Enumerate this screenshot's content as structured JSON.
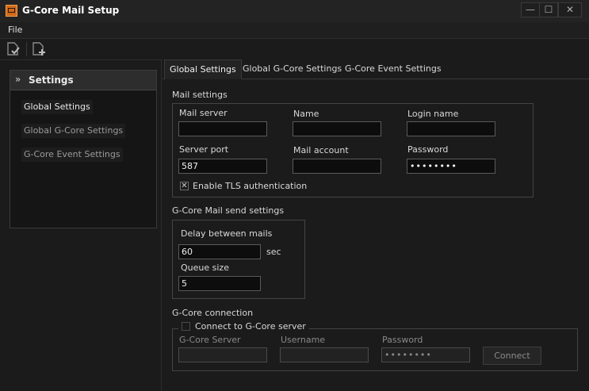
{
  "window": {
    "title": "G-Core Mail Setup",
    "controls": [
      "—",
      "☐",
      "✕"
    ]
  },
  "menu": {
    "file": "File"
  },
  "toolbar": {
    "icons": [
      "document-check-icon",
      "document-add-icon"
    ]
  },
  "sidebar": {
    "header": "Settings",
    "items": [
      {
        "label": "Global Settings"
      },
      {
        "label": "Global G-Core Settings"
      },
      {
        "label": "G-Core Event Settings"
      }
    ]
  },
  "tabs": [
    "Global Settings",
    "Global G-Core Settings",
    "G-Core Event Settings"
  ],
  "mail_settings": {
    "title": "Mail settings",
    "mail_server": {
      "label": "Mail server",
      "value": ""
    },
    "name": {
      "label": "Name",
      "value": ""
    },
    "login_name": {
      "label": "Login name",
      "value": ""
    },
    "server_port": {
      "label": "Server port",
      "value": "587"
    },
    "mail_account": {
      "label": "Mail account",
      "value": ""
    },
    "password": {
      "label": "Password",
      "value": "••••••••"
    },
    "tls": {
      "label": "Enable TLS authentication",
      "checked": true,
      "mark": "✕"
    }
  },
  "send_settings": {
    "title": "G-Core Mail send settings",
    "delay": {
      "label": "Delay between mails",
      "value": "60",
      "unit": "sec"
    },
    "queue": {
      "label": "Queue size",
      "value": "5"
    }
  },
  "connection": {
    "title": "G-Core connection",
    "connect_label": "Connect to G-Core server",
    "server": {
      "label": "G-Core Server",
      "value": ""
    },
    "username": {
      "label": "Username",
      "value": ""
    },
    "password": {
      "label": "Password",
      "value": "••••••••"
    },
    "connect_button": "Connect"
  }
}
